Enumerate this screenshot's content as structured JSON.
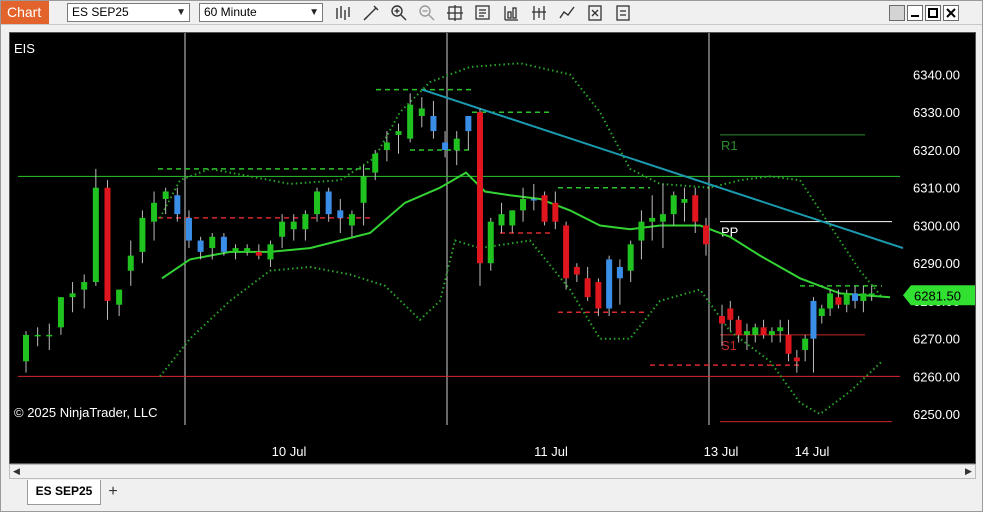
{
  "window": {
    "app_tab": "Chart",
    "instrument": "ES SEP25",
    "interval": "60 Minute",
    "toolbar_icons": [
      "bar-type-icon",
      "drawing-tool-icon",
      "zoom-in-icon",
      "zoom-out-icon",
      "crosshair-icon",
      "data-box-icon",
      "indicators-icon",
      "strategies-icon",
      "chart-trader-icon",
      "properties-icon",
      "share-icon"
    ],
    "window_buttons": [
      "restore-icon",
      "minimize-icon",
      "maximize-icon",
      "close-icon"
    ]
  },
  "chart": {
    "instrument_label": "EIS",
    "copyright": "© 2025 NinjaTrader, LLC",
    "price_ticks": [
      "6340.00",
      "6330.00",
      "6320.00",
      "6310.00",
      "6300.00",
      "6290.00",
      "6280.00",
      "6270.00",
      "6260.00",
      "6250.00"
    ],
    "date_labels": [
      "10 Jul",
      "11 Jul",
      "13 Jul",
      "14 Jul"
    ],
    "last_price": "6281.50",
    "pivot_labels": {
      "r1": "R1",
      "pp": "PP",
      "s1": "S1"
    },
    "colors": {
      "up": "#1fc21f",
      "down": "#e0161e",
      "up_alt": "#3b8ee8",
      "ma": "#34d334",
      "band": "#2aa62a",
      "trend": "#1b9ab0",
      "r1": "#2e8b2e",
      "s1": "#c62828",
      "pp": "#ffffff",
      "last_price_bg": "#32e032"
    }
  },
  "chart_data": {
    "type": "candlestick",
    "instrument": "EIS",
    "interval": "60 Minute",
    "y_unit": "price",
    "ylim": [
      6245,
      6351
    ],
    "x_tick_labels": [
      "10 Jul",
      "11 Jul",
      "13 Jul",
      "14 Jul"
    ],
    "last_price": 6281.5,
    "candles": [
      {
        "o": 6264,
        "h": 6272,
        "l": 6261,
        "c": 6271,
        "col": "up"
      },
      {
        "o": 6271,
        "h": 6273,
        "l": 6268,
        "c": 6271,
        "col": "up"
      },
      {
        "o": 6271,
        "h": 6274,
        "l": 6267,
        "c": 6271,
        "col": "up"
      },
      {
        "o": 6273,
        "h": 6281,
        "l": 6271,
        "c": 6281,
        "col": "up"
      },
      {
        "o": 6281,
        "h": 6285,
        "l": 6277,
        "c": 6282,
        "col": "up"
      },
      {
        "o": 6283,
        "h": 6287,
        "l": 6278,
        "c": 6285,
        "col": "up"
      },
      {
        "o": 6285,
        "h": 6315,
        "l": 6284,
        "c": 6310,
        "col": "up"
      },
      {
        "o": 6310,
        "h": 6312,
        "l": 6275,
        "c": 6280,
        "col": "down"
      },
      {
        "o": 6279,
        "h": 6283,
        "l": 6276,
        "c": 6283,
        "col": "up"
      },
      {
        "o": 6288,
        "h": 6296,
        "l": 6284,
        "c": 6292,
        "col": "up"
      },
      {
        "o": 6293,
        "h": 6304,
        "l": 6290,
        "c": 6302,
        "col": "up"
      },
      {
        "o": 6301,
        "h": 6309,
        "l": 6296,
        "c": 6306,
        "col": "up"
      },
      {
        "o": 6307,
        "h": 6310,
        "l": 6303,
        "c": 6309,
        "col": "up"
      },
      {
        "o": 6308,
        "h": 6310,
        "l": 6301,
        "c": 6303,
        "col": "up_alt"
      },
      {
        "o": 6302,
        "h": 6304,
        "l": 6294,
        "c": 6296,
        "col": "up_alt"
      },
      {
        "o": 6296,
        "h": 6297,
        "l": 6291,
        "c": 6293,
        "col": "up_alt"
      },
      {
        "o": 6294,
        "h": 6298,
        "l": 6291,
        "c": 6297,
        "col": "up"
      },
      {
        "o": 6297,
        "h": 6298,
        "l": 6292,
        "c": 6293,
        "col": "up_alt"
      },
      {
        "o": 6293,
        "h": 6295,
        "l": 6291,
        "c": 6294,
        "col": "up"
      },
      {
        "o": 6294,
        "h": 6295,
        "l": 6292,
        "c": 6293,
        "col": "up"
      },
      {
        "o": 6293,
        "h": 6295,
        "l": 6291,
        "c": 6292,
        "col": "down"
      },
      {
        "o": 6291,
        "h": 6296,
        "l": 6289,
        "c": 6295,
        "col": "up"
      },
      {
        "o": 6297,
        "h": 6303,
        "l": 6294,
        "c": 6301,
        "col": "up"
      },
      {
        "o": 6299,
        "h": 6303,
        "l": 6296,
        "c": 6301,
        "col": "up"
      },
      {
        "o": 6299,
        "h": 6304,
        "l": 6296,
        "c": 6303,
        "col": "up"
      },
      {
        "o": 6303,
        "h": 6310,
        "l": 6301,
        "c": 6309,
        "col": "up"
      },
      {
        "o": 6309,
        "h": 6310,
        "l": 6301,
        "c": 6303,
        "col": "up_alt"
      },
      {
        "o": 6304,
        "h": 6307,
        "l": 6298,
        "c": 6302,
        "col": "up_alt"
      },
      {
        "o": 6300,
        "h": 6304,
        "l": 6297,
        "c": 6303,
        "col": "up"
      },
      {
        "o": 6306,
        "h": 6316,
        "l": 6300,
        "c": 6313,
        "col": "up"
      },
      {
        "o": 6314,
        "h": 6320,
        "l": 6312,
        "c": 6319,
        "col": "up"
      },
      {
        "o": 6320,
        "h": 6325,
        "l": 6317,
        "c": 6322,
        "col": "up"
      },
      {
        "o": 6324,
        "h": 6327,
        "l": 6319,
        "c": 6325,
        "col": "up"
      },
      {
        "o": 6323,
        "h": 6335,
        "l": 6322,
        "c": 6332,
        "col": "up"
      },
      {
        "o": 6331,
        "h": 6334,
        "l": 6326,
        "c": 6329,
        "col": "up"
      },
      {
        "o": 6329,
        "h": 6333,
        "l": 6323,
        "c": 6325,
        "col": "up_alt"
      },
      {
        "o": 6322,
        "h": 6325,
        "l": 6318,
        "c": 6320,
        "col": "up_alt"
      },
      {
        "o": 6320,
        "h": 6325,
        "l": 6316,
        "c": 6323,
        "col": "up"
      },
      {
        "o": 6325,
        "h": 6329,
        "l": 6320,
        "c": 6329,
        "col": "up_alt"
      },
      {
        "o": 6329,
        "h": 6331,
        "l": 6326,
        "c": 6330,
        "col": "down"
      },
      {
        "o": 6330,
        "h": 6331,
        "l": 6284,
        "c": 6290,
        "col": "down"
      },
      {
        "o": 6290,
        "h": 6302,
        "l": 6288,
        "c": 6301,
        "col": "up"
      },
      {
        "o": 6303,
        "h": 6306,
        "l": 6298,
        "c": 6300,
        "col": "up"
      },
      {
        "o": 6300,
        "h": 6304,
        "l": 6298,
        "c": 6304,
        "col": "up"
      },
      {
        "o": 6304,
        "h": 6310,
        "l": 6301,
        "c": 6307,
        "col": "up"
      },
      {
        "o": 6307,
        "h": 6311,
        "l": 6304,
        "c": 6307,
        "col": "up_alt"
      },
      {
        "o": 6308,
        "h": 6309,
        "l": 6300,
        "c": 6301,
        "col": "down"
      },
      {
        "o": 6306,
        "h": 6309,
        "l": 6299,
        "c": 6301,
        "col": "down"
      },
      {
        "o": 6300,
        "h": 6301,
        "l": 6283,
        "c": 6286,
        "col": "down"
      },
      {
        "o": 6289,
        "h": 6290,
        "l": 6285,
        "c": 6287,
        "col": "down"
      },
      {
        "o": 6286,
        "h": 6289,
        "l": 6280,
        "c": 6281,
        "col": "down"
      },
      {
        "o": 6285,
        "h": 6286,
        "l": 6276,
        "c": 6278,
        "col": "down"
      },
      {
        "o": 6278,
        "h": 6292,
        "l": 6276,
        "c": 6291,
        "col": "up_alt"
      },
      {
        "o": 6286,
        "h": 6291,
        "l": 6279,
        "c": 6289,
        "col": "up_alt"
      },
      {
        "o": 6288,
        "h": 6296,
        "l": 6285,
        "c": 6295,
        "col": "up"
      },
      {
        "o": 6296,
        "h": 6304,
        "l": 6291,
        "c": 6301,
        "col": "up"
      },
      {
        "o": 6301,
        "h": 6308,
        "l": 6296,
        "c": 6302,
        "col": "up"
      },
      {
        "o": 6301,
        "h": 6311,
        "l": 6294,
        "c": 6303,
        "col": "up"
      },
      {
        "o": 6303,
        "h": 6309,
        "l": 6300,
        "c": 6308,
        "col": "up"
      },
      {
        "o": 6307,
        "h": 6310,
        "l": 6301,
        "c": 6306,
        "col": "up"
      },
      {
        "o": 6308,
        "h": 6310,
        "l": 6298,
        "c": 6301,
        "col": "down"
      },
      {
        "o": 6300,
        "h": 6302,
        "l": 6292,
        "c": 6295,
        "col": "down"
      },
      {
        "o": 6276,
        "h": 6279,
        "l": 6268,
        "c": 6274,
        "col": "down"
      },
      {
        "o": 6278,
        "h": 6280,
        "l": 6272,
        "c": 6275,
        "col": "down"
      },
      {
        "o": 6275,
        "h": 6276,
        "l": 6269,
        "c": 6271,
        "col": "down"
      },
      {
        "o": 6271,
        "h": 6274,
        "l": 6267,
        "c": 6272,
        "col": "up"
      },
      {
        "o": 6271,
        "h": 6274,
        "l": 6269,
        "c": 6273,
        "col": "up"
      },
      {
        "o": 6273,
        "h": 6275,
        "l": 6270,
        "c": 6271,
        "col": "down"
      },
      {
        "o": 6271,
        "h": 6273,
        "l": 6269,
        "c": 6272,
        "col": "up"
      },
      {
        "o": 6272,
        "h": 6275,
        "l": 6269,
        "c": 6273,
        "col": "up"
      },
      {
        "o": 6271,
        "h": 6275,
        "l": 6264,
        "c": 6266,
        "col": "down"
      },
      {
        "o": 6265,
        "h": 6267,
        "l": 6261,
        "c": 6264,
        "col": "down"
      },
      {
        "o": 6267,
        "h": 6271,
        "l": 6264,
        "c": 6270,
        "col": "up"
      },
      {
        "o": 6270,
        "h": 6281,
        "l": 6261,
        "c": 6280,
        "col": "up_alt"
      },
      {
        "o": 6276,
        "h": 6279,
        "l": 6274,
        "c": 6278,
        "col": "up"
      },
      {
        "o": 6278,
        "h": 6283,
        "l": 6276,
        "c": 6282,
        "col": "up"
      },
      {
        "o": 6281,
        "h": 6283,
        "l": 6278,
        "c": 6279,
        "col": "down"
      },
      {
        "o": 6279,
        "h": 6283,
        "l": 6277,
        "c": 6282,
        "col": "up"
      },
      {
        "o": 6282,
        "h": 6284,
        "l": 6278,
        "c": 6280,
        "col": "up_alt"
      },
      {
        "o": 6280,
        "h": 6284,
        "l": 6277,
        "c": 6282,
        "col": "up"
      },
      {
        "o": 6282,
        "h": 6284,
        "l": 6280,
        "c": 6281.5,
        "col": "up"
      }
    ],
    "moving_average": [
      [
        0,
        6286
      ],
      [
        8,
        6292
      ],
      [
        16,
        6296
      ],
      [
        24,
        6302
      ],
      [
        30,
        6313
      ],
      [
        36,
        6319
      ],
      [
        41,
        6313
      ],
      [
        48,
        6310
      ],
      [
        55,
        6307
      ],
      [
        60,
        6300
      ],
      [
        62,
        6299
      ],
      [
        66,
        6296
      ],
      [
        70,
        6291
      ],
      [
        74,
        6288
      ],
      [
        78,
        6284
      ],
      [
        81,
        6282
      ]
    ],
    "pivot_levels": {
      "current": {
        "R1": 6324,
        "PP": 6301,
        "S1": 6271
      },
      "previous_day_resistance": 6313,
      "support": 6260
    }
  }
}
